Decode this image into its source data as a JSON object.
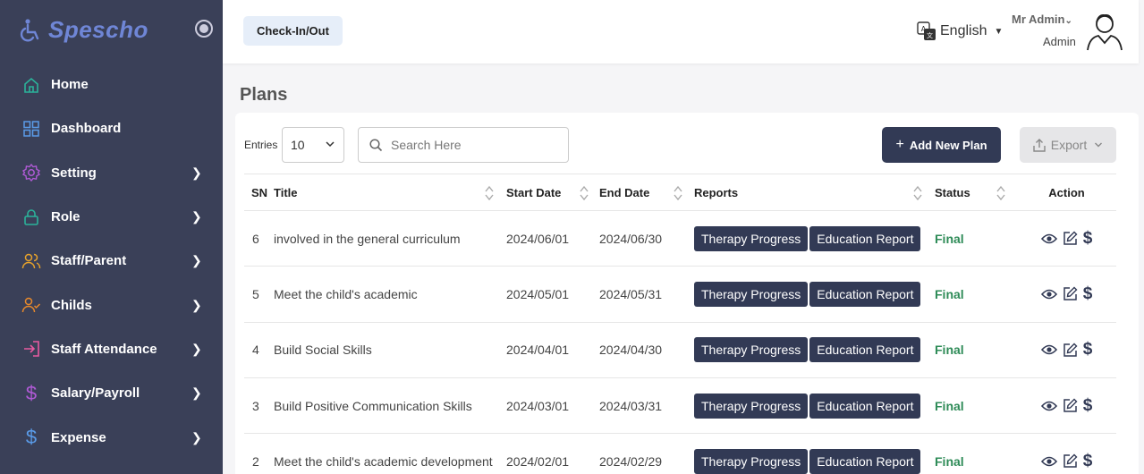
{
  "brand": {
    "name": "Spescho"
  },
  "sidebar": {
    "items": [
      {
        "label": "Home",
        "icon": "home-icon",
        "color": "#2bb39a",
        "has_arrow": false
      },
      {
        "label": "Dashboard",
        "icon": "grid-icon",
        "color": "#5a9be8",
        "has_arrow": false
      },
      {
        "label": "Setting",
        "icon": "gear-icon",
        "color": "#b05ad6",
        "has_arrow": true
      },
      {
        "label": "Role",
        "icon": "lock-icon",
        "color": "#2bb39a",
        "has_arrow": true
      },
      {
        "label": "Staff/Parent",
        "icon": "users-icon",
        "color": "#e8a32b",
        "has_arrow": true
      },
      {
        "label": "Childs",
        "icon": "user-check-icon",
        "color": "#e8892b",
        "has_arrow": true
      },
      {
        "label": "Staff Attendance",
        "icon": "login-icon",
        "color": "#e85aa0",
        "has_arrow": true
      },
      {
        "label": "Salary/Payroll",
        "icon": "dollar-icon",
        "color": "#b05ad6",
        "has_arrow": true
      },
      {
        "label": "Expense",
        "icon": "dollar-icon",
        "color": "#5a9be8",
        "has_arrow": true
      }
    ]
  },
  "header": {
    "checkin_label": "Check-In/Out",
    "language": "English",
    "user_name": "Mr Admin",
    "user_role": "Admin"
  },
  "page": {
    "title": "Plans"
  },
  "toolbar": {
    "entries_label": "Entries",
    "entries_value": "10",
    "search_placeholder": "Search Here",
    "add_label": "Add New Plan",
    "export_label": "Export"
  },
  "table": {
    "headers": {
      "sn": "SN",
      "title": "Title",
      "start": "Start Date",
      "end": "End Date",
      "reports": "Reports",
      "status": "Status",
      "action": "Action"
    },
    "rows": [
      {
        "sn": "6",
        "title": "involved in the general curriculum",
        "start": "2024/06/01",
        "end": "2024/06/30",
        "report1": "Therapy Progress",
        "report2": "Education Report",
        "status": "Final"
      },
      {
        "sn": "5",
        "title": "Meet the child's academic",
        "start": "2024/05/01",
        "end": "2024/05/31",
        "report1": "Therapy Progress",
        "report2": "Education Report",
        "status": "Final"
      },
      {
        "sn": "4",
        "title": "Build Social Skills",
        "start": "2024/04/01",
        "end": "2024/04/30",
        "report1": "Therapy Progress",
        "report2": "Education Report",
        "status": "Final"
      },
      {
        "sn": "3",
        "title": "Build Positive Communication Skills",
        "start": "2024/03/01",
        "end": "2024/03/31",
        "report1": "Therapy Progress",
        "report2": "Education Report",
        "status": "Final"
      },
      {
        "sn": "2",
        "title": "Meet the child's academic development",
        "start": "2024/02/01",
        "end": "2024/02/29",
        "report1": "Therapy Progress",
        "report2": "Education Report",
        "status": "Final"
      }
    ]
  },
  "colors": {
    "sidebar_bg": "#3a4058",
    "primary": "#323a55",
    "status_final": "#2e8b57",
    "brand": "#6f86d6"
  }
}
